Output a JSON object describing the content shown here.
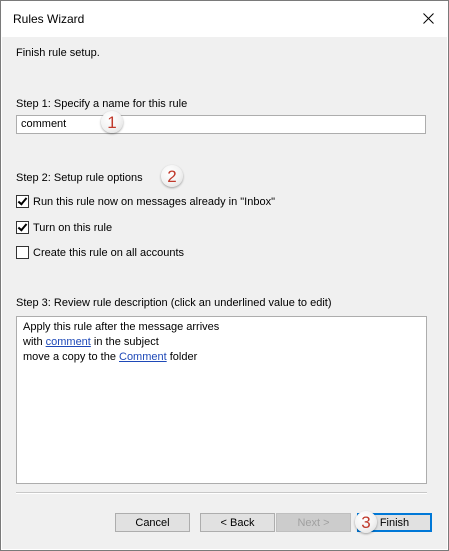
{
  "window": {
    "title": "Rules Wizard"
  },
  "intro": "Finish rule setup.",
  "step1": {
    "label": "Step 1: Specify a name for this rule",
    "name_value": "comment",
    "callout": "1"
  },
  "step2": {
    "label": "Step 2: Setup rule options",
    "callout": "2",
    "options": [
      {
        "label": "Run this rule now on messages already in \"Inbox\"",
        "checked": true
      },
      {
        "label": "Turn on this rule",
        "checked": true
      },
      {
        "label": "Create this rule on all accounts",
        "checked": false
      }
    ]
  },
  "step3": {
    "label": "Step 3: Review rule description (click an underlined value to edit)",
    "line1": "Apply this rule after the message arrives",
    "line2_prefix": "with ",
    "line2_link": "comment",
    "line2_suffix": " in the subject",
    "line3_prefix": "move a copy to the ",
    "line3_link": "Comment",
    "line3_suffix": " folder"
  },
  "buttons": {
    "cancel": "Cancel",
    "back": "< Back",
    "next": "Next >",
    "finish": "Finish",
    "callout": "3"
  },
  "colors": {
    "link": "#1e49b8",
    "callout_number": "#c0392b",
    "dialog_bg": "#f0f0f0"
  }
}
